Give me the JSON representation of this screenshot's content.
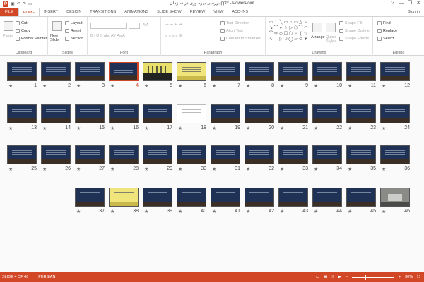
{
  "titlebar": {
    "app_icon": "P",
    "title": "بررسی بهره وری در سازمان.pptx - PowerPoint",
    "help": "?",
    "minimize": "—",
    "restore": "❐",
    "close": "✕"
  },
  "tabs": {
    "file": "FILE",
    "home": "HOME",
    "insert": "INSERT",
    "design": "DESIGN",
    "transitions": "TRANSITIONS",
    "animations": "ANIMATIONS",
    "slideshow": "SLIDE SHOW",
    "review": "REVIEW",
    "view": "VIEW",
    "addins": "ADD-INS",
    "signin": "Sign in"
  },
  "ribbon": {
    "clipboard": {
      "paste": "Paste",
      "cut": "Cut",
      "copy": "Copy",
      "format_painter": "Format Painter",
      "label": "Clipboard"
    },
    "slides": {
      "new_slide": "New Slide",
      "layout": "Layout",
      "reset": "Reset",
      "section": "Section",
      "label": "Slides"
    },
    "font": {
      "label": "Font"
    },
    "paragraph": {
      "text_direction": "Text Direction",
      "align_text": "Align Text",
      "smartart": "Convert to SmartArt",
      "label": "Paragraph"
    },
    "drawing": {
      "arrange": "Arrange",
      "quick_styles": "Quick Styles",
      "shape_fill": "Shape Fill",
      "shape_outline": "Shape Outline",
      "shape_effects": "Shape Effects",
      "label": "Drawing"
    },
    "editing": {
      "find": "Find",
      "replace": "Replace",
      "select": "Select",
      "label": "Editing"
    }
  },
  "slides": [
    {
      "n": "12"
    },
    {
      "n": "11"
    },
    {
      "n": "10"
    },
    {
      "n": "9"
    },
    {
      "n": "8"
    },
    {
      "n": "7"
    },
    {
      "n": "6"
    },
    {
      "n": "5"
    },
    {
      "n": "4"
    },
    {
      "n": "3"
    },
    {
      "n": "2"
    },
    {
      "n": "1"
    },
    {
      "n": "24"
    },
    {
      "n": "23"
    },
    {
      "n": "22"
    },
    {
      "n": "21"
    },
    {
      "n": "20"
    },
    {
      "n": "19"
    },
    {
      "n": "18"
    },
    {
      "n": "17"
    },
    {
      "n": "16"
    },
    {
      "n": "15"
    },
    {
      "n": "14"
    },
    {
      "n": "13"
    },
    {
      "n": "36"
    },
    {
      "n": "35"
    },
    {
      "n": "34"
    },
    {
      "n": "33"
    },
    {
      "n": "32"
    },
    {
      "n": "31"
    },
    {
      "n": "30"
    },
    {
      "n": "29"
    },
    {
      "n": "28"
    },
    {
      "n": "27"
    },
    {
      "n": "26"
    },
    {
      "n": "25"
    },
    {
      "n": "46"
    },
    {
      "n": "45"
    },
    {
      "n": "44"
    },
    {
      "n": "43"
    },
    {
      "n": "42"
    },
    {
      "n": "41"
    },
    {
      "n": "40"
    },
    {
      "n": "39"
    },
    {
      "n": "38"
    },
    {
      "n": "37"
    }
  ],
  "selected_slide": "4",
  "statusbar": {
    "slide_of": "SLIDE 4 OF 46",
    "language": "PERSIAN",
    "zoom": "30%"
  },
  "colors": {
    "accent": "#d24726"
  }
}
